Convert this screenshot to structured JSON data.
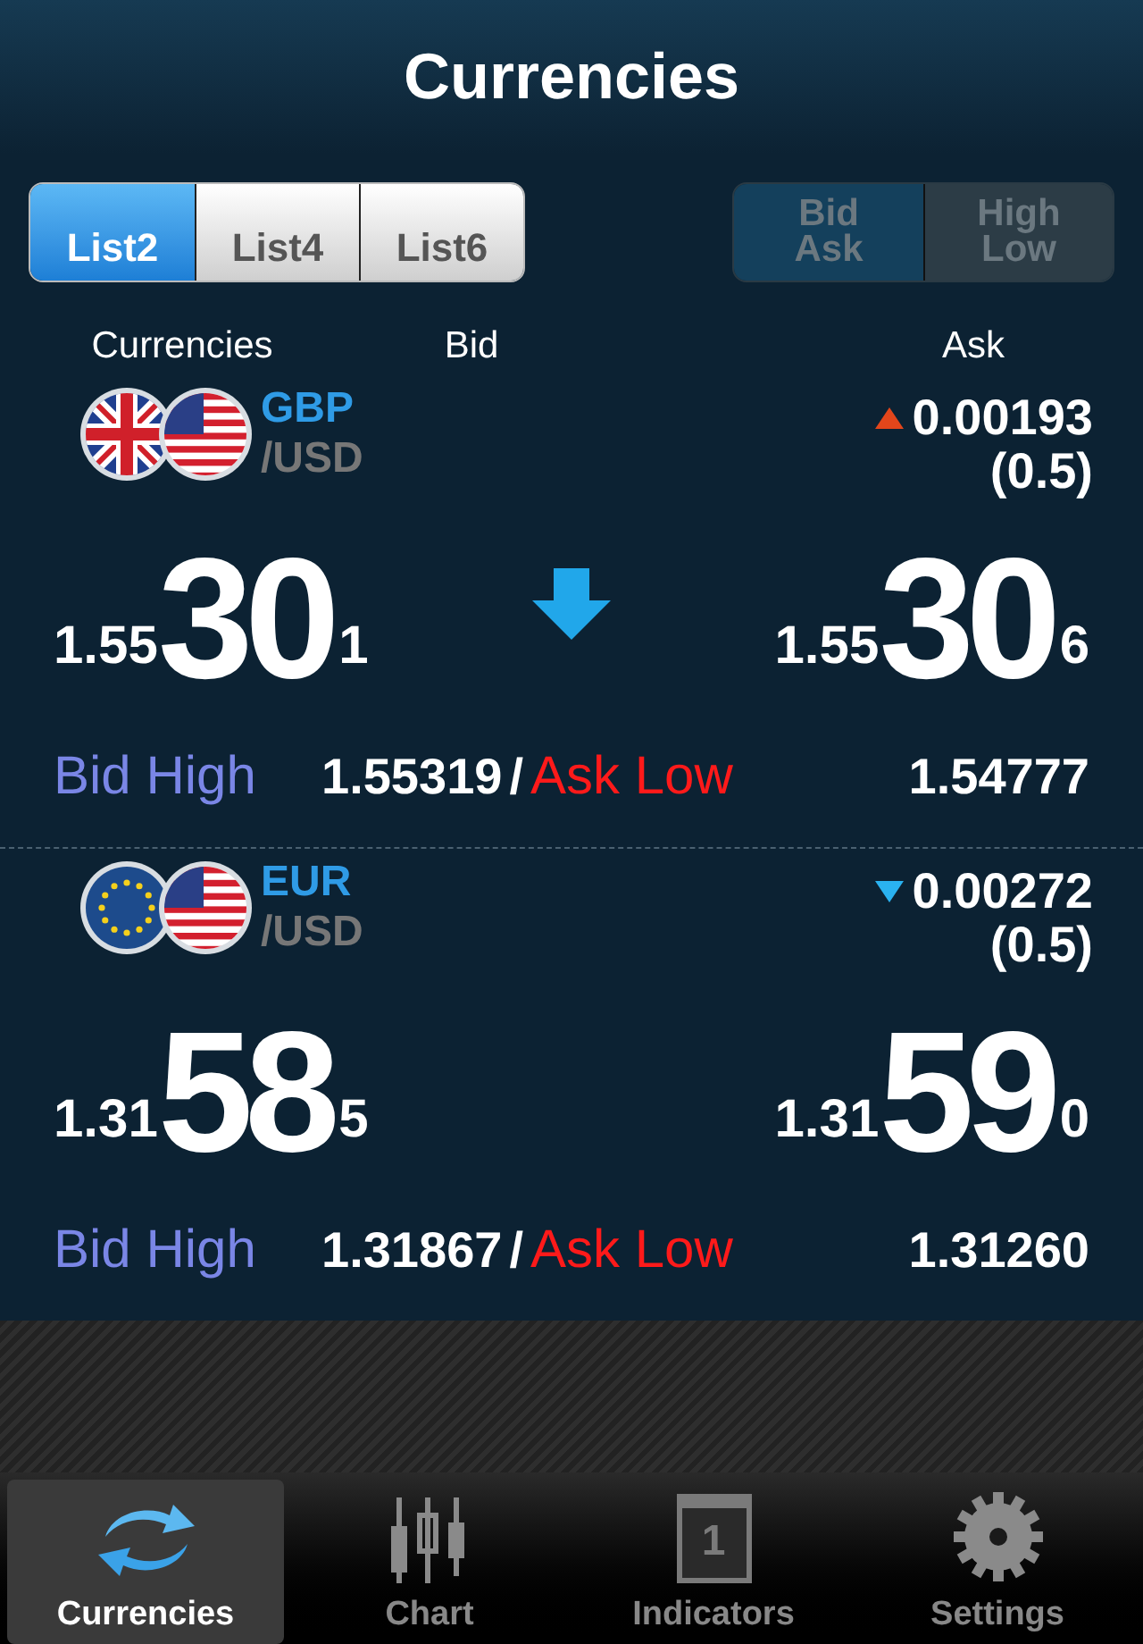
{
  "header": {
    "title": "Currencies"
  },
  "list_tabs": [
    {
      "label": "List2",
      "selected": true
    },
    {
      "label": "List4",
      "selected": false
    },
    {
      "label": "List6",
      "selected": false
    }
  ],
  "mode_toggle": [
    {
      "label": "Bid\nAsk",
      "selected": true
    },
    {
      "label": "High\nLow",
      "selected": false
    }
  ],
  "columns": [
    "Currencies",
    "Bid",
    "Ask"
  ],
  "rows": [
    {
      "base": "GBP",
      "quote": "/USD",
      "rising": true,
      "change": "0.00193",
      "spread": "(0.5)",
      "arrow_down": true,
      "bid": {
        "prefix": "1.55",
        "big": "30",
        "small": "1"
      },
      "ask": {
        "prefix": "1.55",
        "big": "30",
        "small": "6"
      },
      "high_label": "Bid High",
      "high": "1.55319",
      "sep": "/",
      "low_label": "Ask Low",
      "low": "1.54777"
    },
    {
      "base": "EUR",
      "quote": "/USD",
      "rising": false,
      "arrow_down": false,
      "change": "0.00272",
      "spread": "(0.5)",
      "bid": {
        "prefix": "1.31",
        "big": "58",
        "small": "5"
      },
      "ask": {
        "prefix": "1.31",
        "big": "59",
        "small": "0"
      },
      "high_label": "Bid High",
      "high": "1.31867",
      "sep": "/",
      "low_label": "Ask Low",
      "low": "1.31260"
    }
  ],
  "tab_bar": [
    {
      "label": "Currencies",
      "selected": true
    },
    {
      "label": "Chart",
      "selected": false
    },
    {
      "label": "Indicators",
      "selected": false,
      "badge": "1"
    },
    {
      "label": "Settings",
      "selected": false
    }
  ]
}
